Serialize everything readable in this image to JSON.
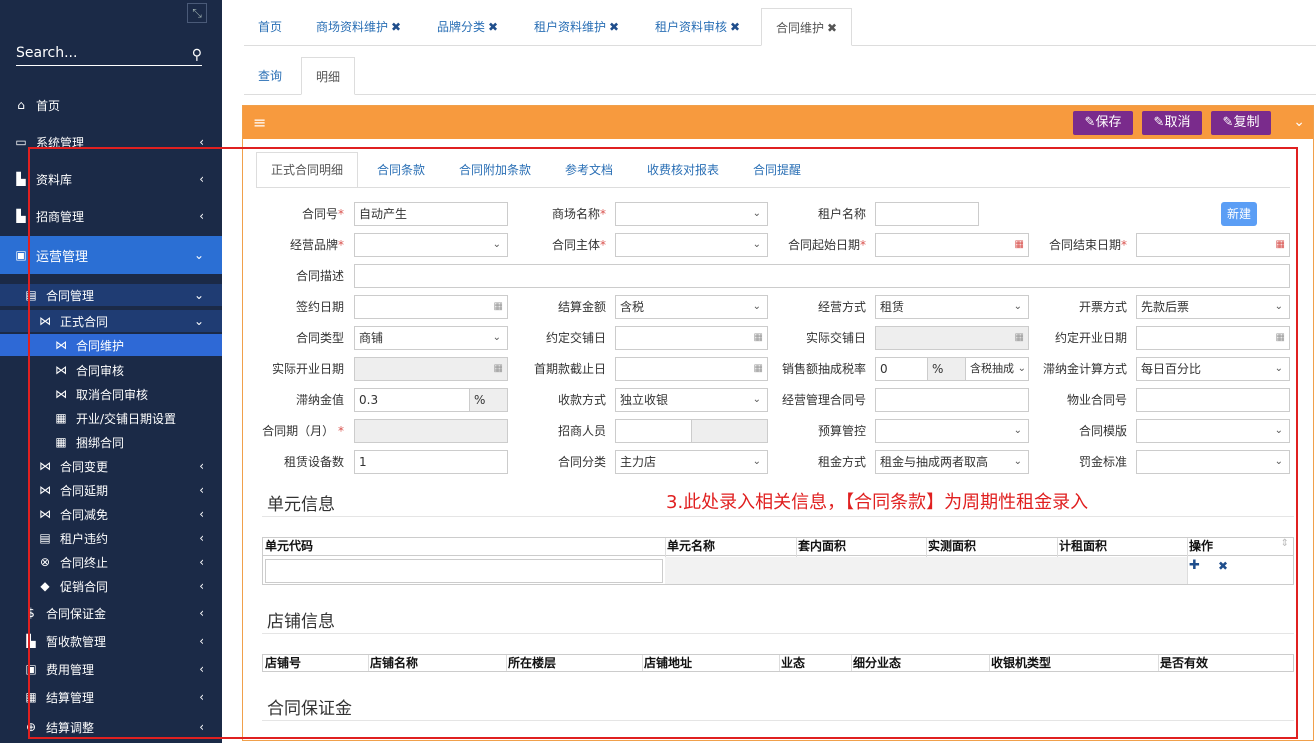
{
  "sidebar": {
    "search_placeholder": "Search...",
    "items": [
      {
        "label": "首页",
        "icon": "home-icon"
      },
      {
        "label": "系统管理",
        "icon": "monitor-icon"
      },
      {
        "label": "资料库",
        "icon": "bar-chart-icon"
      },
      {
        "label": "招商管理",
        "icon": "bar-chart-icon"
      },
      {
        "label": "运营管理",
        "icon": "comments-icon"
      },
      {
        "label": "合同管理",
        "icon": "document-icon"
      },
      {
        "label": "正式合同",
        "icon": "handshake-icon"
      },
      {
        "label": "合同维护",
        "icon": "handshake-icon"
      },
      {
        "label": "合同审核",
        "icon": "handshake-icon"
      },
      {
        "label": "取消合同审核",
        "icon": "handshake-icon"
      },
      {
        "label": "开业/交铺日期设置",
        "icon": "calendar-icon"
      },
      {
        "label": "捆绑合同",
        "icon": "calendar-icon"
      },
      {
        "label": "合同变更",
        "icon": "handshake-icon"
      },
      {
        "label": "合同延期",
        "icon": "handshake-icon"
      },
      {
        "label": "合同减免",
        "icon": "handshake-icon"
      },
      {
        "label": "租户违约",
        "icon": "document-icon"
      },
      {
        "label": "合同终止",
        "icon": "close-circle-icon"
      },
      {
        "label": "促销合同",
        "icon": "tag-icon"
      },
      {
        "label": "合同保证金",
        "icon": "money-icon"
      },
      {
        "label": "暂收款管理",
        "icon": "bar-chart-icon"
      },
      {
        "label": "费用管理",
        "icon": "money-icon"
      },
      {
        "label": "结算管理",
        "icon": "table-icon"
      },
      {
        "label": "结算调整",
        "icon": "search-plus-icon"
      }
    ]
  },
  "tabs": [
    "首页",
    "商场资料维护",
    "品牌分类",
    "租户资料维护",
    "租户资料审核",
    "合同维护"
  ],
  "subtabs": [
    "查询",
    "明细"
  ],
  "toolbar": {
    "save": "保存",
    "cancel": "取消",
    "copy": "复制"
  },
  "inner_tabs": [
    "正式合同明细",
    "合同条款",
    "合同附加条款",
    "参考文档",
    "收费核对报表",
    "合同提醒"
  ],
  "form": {
    "contract_no": {
      "label": "合同号",
      "value": "自动产生"
    },
    "mall_name": {
      "label": "商场名称"
    },
    "tenant_name": {
      "label": "租户名称"
    },
    "new_btn": "新建",
    "brand": {
      "label": "经营品牌"
    },
    "subject": {
      "label": "合同主体"
    },
    "start_date": {
      "label": "合同起始日期"
    },
    "end_date": {
      "label": "合同结束日期"
    },
    "desc": {
      "label": "合同描述"
    },
    "sign_date": {
      "label": "签约日期"
    },
    "settle_amount": {
      "label": "结算金额",
      "value": "含税"
    },
    "biz_mode": {
      "label": "经营方式",
      "value": "租赁"
    },
    "invoice_mode": {
      "label": "开票方式",
      "value": "先款后票"
    },
    "contract_type": {
      "label": "合同类型",
      "value": "商铺"
    },
    "agreed_handover": {
      "label": "约定交铺日"
    },
    "actual_handover": {
      "label": "实际交铺日"
    },
    "agreed_open": {
      "label": "约定开业日期"
    },
    "actual_open": {
      "label": "实际开业日期"
    },
    "first_deadline": {
      "label": "首期款截止日"
    },
    "sales_rate": {
      "label": "销售额抽成税率",
      "value": "0",
      "unit": "%",
      "mode": "含税抽成"
    },
    "late_calc": {
      "label": "滞纳金计算方式",
      "value": "每日百分比"
    },
    "late_value": {
      "label": "滞纳金值",
      "value": "0.3",
      "unit": "%"
    },
    "collect_mode": {
      "label": "收款方式",
      "value": "独立收银"
    },
    "mgmt_contract": {
      "label": "经营管理合同号"
    },
    "property_contract": {
      "label": "物业合同号"
    },
    "period": {
      "label": "合同期（月）"
    },
    "investor": {
      "label": "招商人员"
    },
    "budget": {
      "label": "预算管控"
    },
    "template": {
      "label": "合同模版"
    },
    "equipment_count": {
      "label": "租赁设备数",
      "value": "1"
    },
    "category": {
      "label": "合同分类",
      "value": "主力店"
    },
    "rent_mode": {
      "label": "租金方式",
      "value": "租金与抽成两者取高"
    },
    "penalty": {
      "label": "罚金标准"
    }
  },
  "annotation": "3.此处录入相关信息，【合同条款】为周期性租金录入",
  "unit_section": {
    "title": "单元信息",
    "headers": [
      "单元代码",
      "单元名称",
      "套内面积",
      "实测面积",
      "计租面积",
      "操作"
    ]
  },
  "shop_section": {
    "title": "店铺信息",
    "headers": [
      "店铺号",
      "店铺名称",
      "所在楼层",
      "店铺地址",
      "业态",
      "细分业态",
      "收银机类型",
      "是否有效"
    ]
  },
  "deposit_section": {
    "title": "合同保证金"
  },
  "colors": {
    "sidebar": "#1b2a47",
    "accent": "#2b6fd4",
    "panel_head": "#f79a3e",
    "button": "#7a2b8c",
    "annotation": "#e02020"
  }
}
